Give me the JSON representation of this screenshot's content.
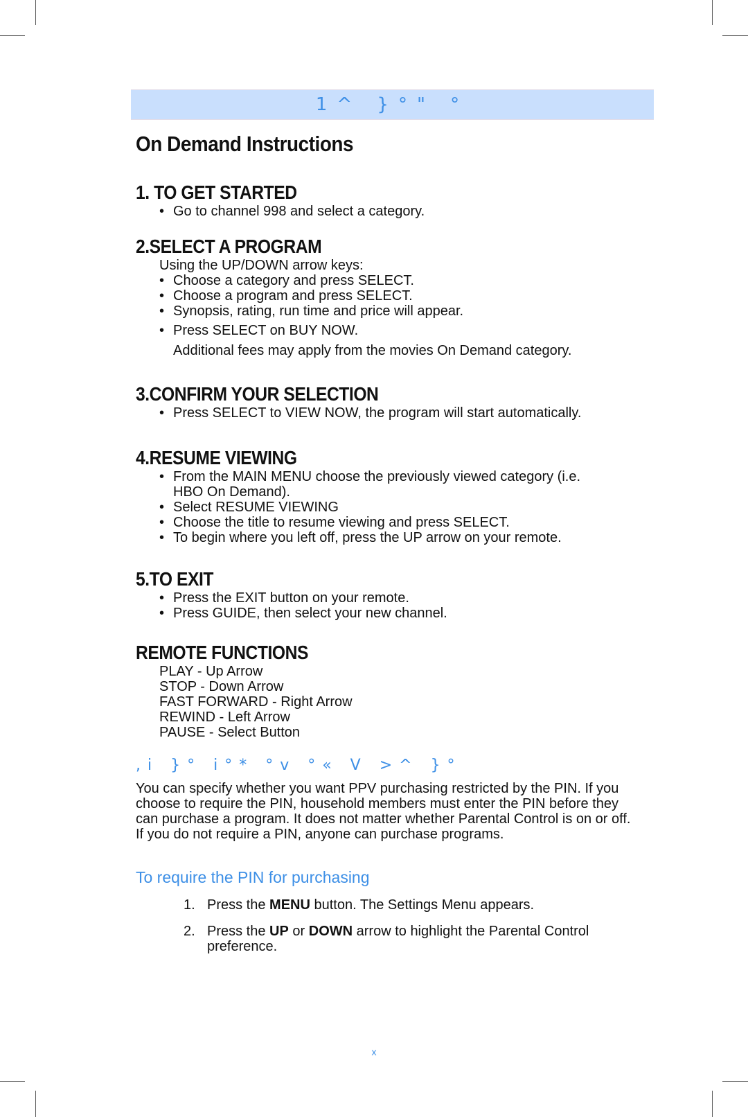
{
  "banner": {
    "text": "1^ }°\" °"
  },
  "title": "On Demand Instructions",
  "sections": [
    {
      "heading": "1. TO GET STARTED",
      "lines": [
        {
          "type": "bullet",
          "text": "Go to channel 998 and select a category."
        }
      ]
    },
    {
      "heading": "2.SELECT A PROGRAM",
      "lines": [
        {
          "type": "plain",
          "text": "Using the UP/DOWN arrow keys:"
        },
        {
          "type": "bullet",
          "text": "Choose a category and press SELECT."
        },
        {
          "type": "bullet",
          "text": "Choose a program and press SELECT."
        },
        {
          "type": "bullet",
          "text": "Synopsis, rating, run time and price will appear."
        },
        {
          "type": "bullet",
          "text": "Press SELECT on BUY NOW."
        },
        {
          "type": "cont",
          "text": "Additional fees may apply from the movies On Demand category."
        }
      ]
    },
    {
      "heading": "3.CONFIRM YOUR SELECTION",
      "lines": [
        {
          "type": "bullet",
          "text": "Press SELECT to VIEW NOW, the program will start automatically."
        }
      ]
    },
    {
      "heading": "4.RESUME VIEWING",
      "lines": [
        {
          "type": "bullet",
          "text": "From the MAIN MENU choose the previously viewed category (i.e."
        },
        {
          "type": "cont",
          "text": "HBO On Demand)."
        },
        {
          "type": "bullet",
          "text": "Select RESUME VIEWING"
        },
        {
          "type": "bullet",
          "text": "Choose the title to resume viewing and press SELECT."
        },
        {
          "type": "bullet",
          "text": "To begin where you left off, press the UP arrow on your remote."
        }
      ]
    },
    {
      "heading": "5.TO EXIT",
      "lines": [
        {
          "type": "bullet",
          "text": "Press the EXIT button on your remote."
        },
        {
          "type": "bullet",
          "text": "Press GUIDE, then select your new channel."
        }
      ]
    },
    {
      "heading": "REMOTE FUNCTIONS",
      "lines": [
        {
          "type": "plain",
          "text": "PLAY -  Up Arrow"
        },
        {
          "type": "plain",
          "text": "STOP - Down Arrow"
        },
        {
          "type": "plain",
          "text": "FAST FORWARD -  Right Arrow"
        },
        {
          "type": "plain",
          "text": "REWIND - Left Arrow"
        },
        {
          "type": "plain",
          "text": "PAUSE -  Select Button"
        }
      ]
    }
  ],
  "pin_section": {
    "subhead": ",i }° i°* °v °« V >^ }°",
    "paragraph": "You can specify whether you want PPV purchasing restricted by the PIN. If you choose to require the PIN, household members must enter the PIN before they can purchase a program. It does not matter whether Parental Control is on or off. If you do not require a PIN, anyone can purchase programs.",
    "procedure_title": "To require the PIN for purchasing",
    "steps": [
      {
        "num": "1.",
        "parts": [
          {
            "t": "Press the "
          },
          {
            "t": "MENU",
            "b": true
          },
          {
            "t": " button. The Settings Menu appears."
          }
        ]
      },
      {
        "num": "2.",
        "parts": [
          {
            "t": "Press the "
          },
          {
            "t": "UP",
            "b": true
          },
          {
            "t": " or "
          },
          {
            "t": "DOWN",
            "b": true
          },
          {
            "t": " arrow to highlight the Parental Control preference."
          }
        ]
      }
    ]
  },
  "page_number": "x",
  "colors": {
    "accent": "#3d8fe6",
    "banner_bg": "#c9dffd"
  }
}
